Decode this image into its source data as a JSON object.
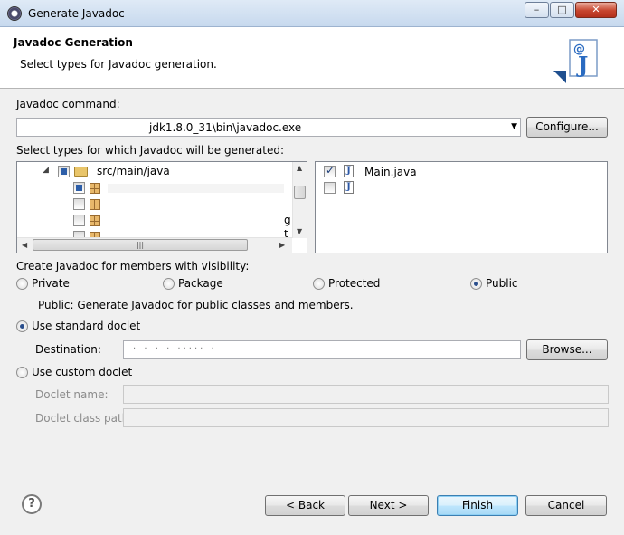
{
  "window": {
    "title": "Generate Javadoc",
    "min": "–",
    "max": "□",
    "close": "✕"
  },
  "header": {
    "title": "Javadoc Generation",
    "subtitle": "Select types for Javadoc generation.",
    "banner_icon": "javadoc-wizard-icon"
  },
  "command": {
    "label": "Javadoc command:",
    "value": "jdk1.8.0_31\\bin\\javadoc.exe",
    "configure_label": "Configure..."
  },
  "types": {
    "label": "Select types for which Javadoc will be generated:",
    "tree_root": "src/main/java",
    "tree_partial": [
      "g",
      "t"
    ],
    "files": [
      {
        "name": "Main.java",
        "checked": true
      },
      {
        "name": "",
        "checked": false
      }
    ]
  },
  "visibility": {
    "label": "Create Javadoc for members with visibility:",
    "options": [
      "Private",
      "Package",
      "Protected",
      "Public"
    ],
    "selected": "Public",
    "description": "Public: Generate Javadoc for public classes and members."
  },
  "doclet": {
    "standard_label": "Use standard doclet",
    "destination_label": "Destination:",
    "browse_label": "Browse...",
    "custom_label": "Use custom doclet",
    "doclet_name_label": "Doclet name:",
    "doclet_class_path_label": "Doclet class path:",
    "selected": "standard"
  },
  "footer": {
    "help": "?",
    "back": "< Back",
    "next": "Next >",
    "finish": "Finish",
    "cancel": "Cancel"
  }
}
